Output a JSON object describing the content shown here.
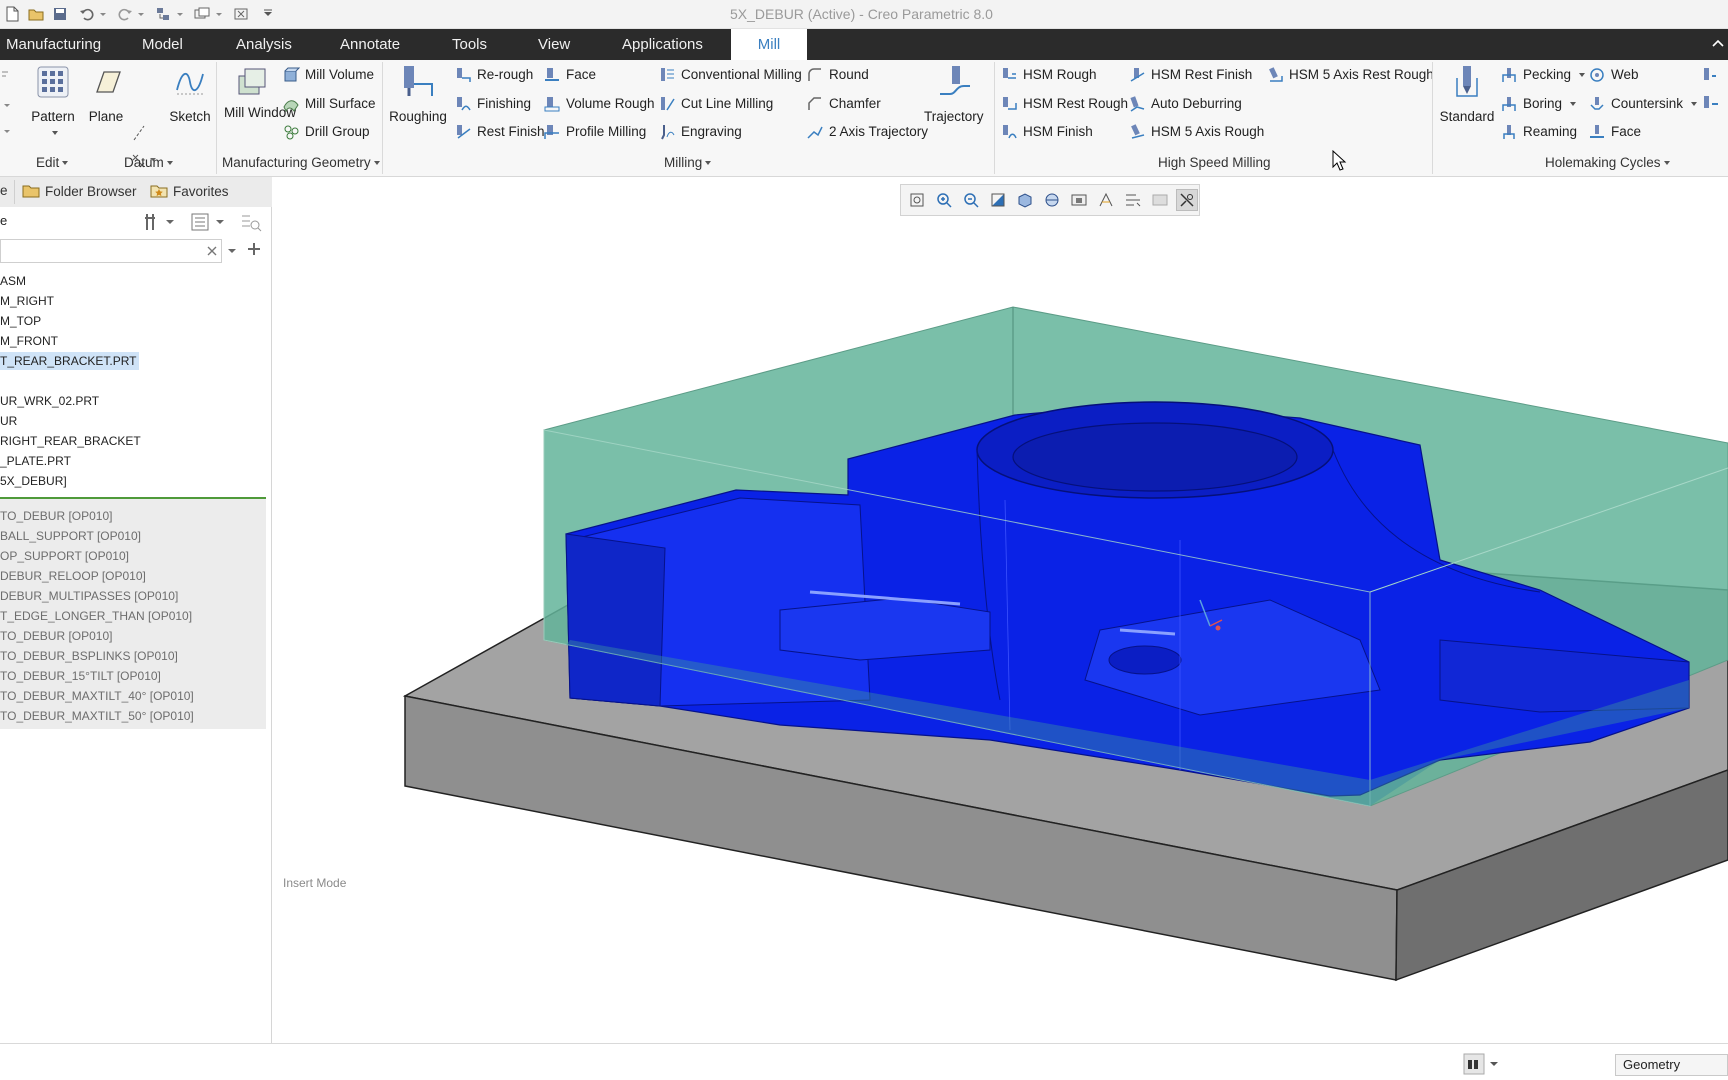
{
  "window": {
    "title": "5X_DEBUR (Active) - Creo Parametric 8.0"
  },
  "menu_tabs": [
    "Manufacturing",
    "Model",
    "Analysis",
    "Annotate",
    "Tools",
    "View",
    "Applications",
    "Mill"
  ],
  "active_tab": "Mill",
  "ribbon": {
    "edit": {
      "pattern": "Pattern",
      "group": "Edit"
    },
    "datum": {
      "plane": "Plane",
      "sketch": "Sketch",
      "group": "Datum"
    },
    "mfg_geometry": {
      "mill_window": "Mill Window",
      "mill_volume": "Mill Volume",
      "mill_surface": "Mill Surface",
      "drill_group": "Drill Group",
      "group": "Manufacturing Geometry"
    },
    "milling": {
      "roughing": "Roughing",
      "re_rough": "Re-rough",
      "finishing": "Finishing",
      "rest_finish": "Rest Finish",
      "face": "Face",
      "volume_rough": "Volume Rough",
      "profile_milling": "Profile Milling",
      "conventional_milling": "Conventional Milling",
      "cut_line_milling": "Cut Line Milling",
      "engraving": "Engraving",
      "round": "Round",
      "chamfer": "Chamfer",
      "two_axis_trajectory": "2 Axis Trajectory",
      "trajectory": "Trajectory",
      "group": "Milling"
    },
    "hsm": {
      "hsm_rough": "HSM Rough",
      "hsm_rest_rough": "HSM Rest Rough",
      "hsm_finish": "HSM Finish",
      "hsm_rest_finish": "HSM Rest Finish",
      "auto_deburring": "Auto Deburring",
      "hsm_5axis_rough": "HSM 5 Axis Rough",
      "hsm_5axis_rest_rough": "HSM 5 Axis Rest Rough",
      "group": "High Speed Milling"
    },
    "holemaking": {
      "standard": "Standard",
      "pecking": "Pecking",
      "boring": "Boring",
      "reaming": "Reaming",
      "web": "Web",
      "countersink": "Countersink",
      "face": "Face",
      "group": "Holemaking Cycles"
    }
  },
  "left_panel": {
    "tabs": {
      "folder_browser": "Folder Browser",
      "favorites": "Favorites",
      "cut_tab": "e"
    },
    "header_text": "e",
    "tree": [
      "ASM",
      "M_RIGHT",
      "M_TOP",
      "M_FRONT",
      "T_REAR_BRACKET.PRT",
      "",
      "UR_WRK_02.PRT",
      "UR",
      "RIGHT_REAR_BRACKET",
      "_PLATE.PRT",
      "5X_DEBUR]"
    ],
    "selected_index": 4,
    "operations": [
      "TO_DEBUR [OP010]",
      "BALL_SUPPORT [OP010]",
      "OP_SUPPORT [OP010]",
      "DEBUR_RELOOP [OP010]",
      "DEBUR_MULTIPASSES [OP010]",
      "T_EDGE_LONGER_THAN [OP010]",
      "TO_DEBUR [OP010]",
      "TO_DEBUR_BSPLINKS [OP010]",
      "TO_DEBUR_15°TILT [OP010]",
      "TO_DEBUR_MAXTILT_40° [OP010]",
      "TO_DEBUR_MAXTILT_50° [OP010]"
    ]
  },
  "viewport": {
    "mode_text": "Insert Mode"
  },
  "status_bar": {
    "filter": "Geometry"
  },
  "colors": {
    "part_blue": "#0a22e6",
    "stock_green": "#4fae8e",
    "fixture_gray": "#9a9a9a",
    "menubar": "#2b2b2b",
    "accent": "#3a7fc0"
  }
}
